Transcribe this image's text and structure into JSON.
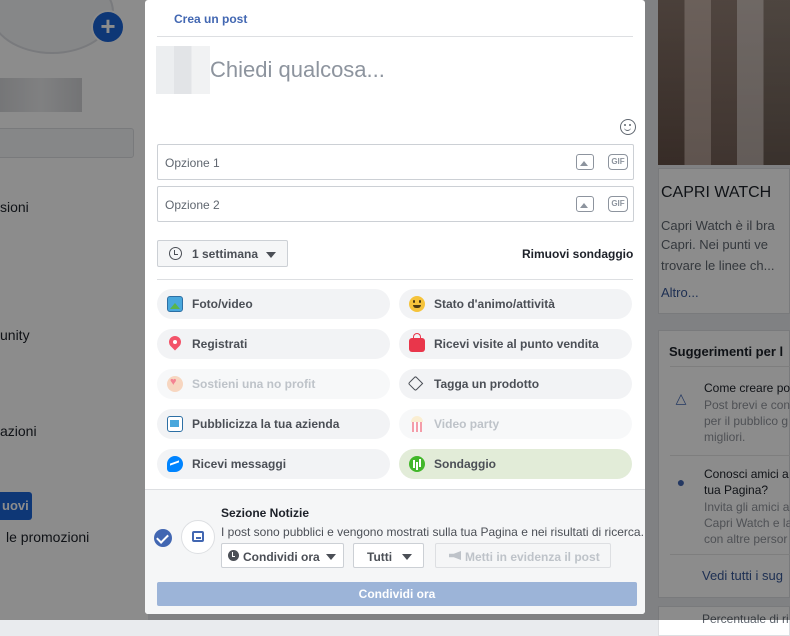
{
  "background_left": {
    "items": [
      "sioni",
      "unity",
      "azioni"
    ],
    "button_label": "uovi",
    "promo_text": "le promozioni"
  },
  "background_right": {
    "page_name": "CAPRI WATCH",
    "description_lines": [
      "Capri Watch è il bra",
      "Capri. Nei punti ve",
      "trovare le linee ch..."
    ],
    "more_link": "Altro...",
    "suggestions_title": "Suggerimenti per l",
    "suggestion1_title": "Come creare po",
    "suggestion1_lines": [
      "Post brevi e con",
      "per il pubblico g",
      "migliori."
    ],
    "suggestion2_title_lines": [
      "Conosci amici a",
      "tua Pagina?"
    ],
    "suggestion2_lines": [
      "Invita gli amici a",
      "Capri Watch e la",
      "con altre persor"
    ],
    "see_all": "Vedi tutti i sug",
    "bottom_text": "Percentuale di ri"
  },
  "modal": {
    "title": "Crea un post",
    "question_placeholder": "Chiedi qualcosa...",
    "options": [
      {
        "placeholder": "Opzione 1",
        "gif_label": "GIF"
      },
      {
        "placeholder": "Opzione 2",
        "gif_label": "GIF"
      }
    ],
    "duration": "1 settimana",
    "remove_poll": "Rimuovi sondaggio",
    "actions": [
      {
        "label": "Foto/video",
        "icon": "photo-icon",
        "state": "normal"
      },
      {
        "label": "Stato d'animo/attività",
        "icon": "smile-icon",
        "state": "normal"
      },
      {
        "label": "Registrati",
        "icon": "location-pin-icon",
        "state": "normal"
      },
      {
        "label": "Ricevi visite al punto vendita",
        "icon": "shopping-bag-icon",
        "state": "normal"
      },
      {
        "label": "Sostieni una no profit",
        "icon": "donation-heart-icon",
        "state": "disabled"
      },
      {
        "label": "Tagga un prodotto",
        "icon": "tag-icon",
        "state": "normal"
      },
      {
        "label": "Pubblicizza la tua azienda",
        "icon": "advertise-icon",
        "state": "normal"
      },
      {
        "label": "Video party",
        "icon": "popcorn-icon",
        "state": "disabled"
      },
      {
        "label": "Ricevi messaggi",
        "icon": "messenger-icon",
        "state": "normal"
      },
      {
        "label": "Sondaggio",
        "icon": "poll-icon",
        "state": "selected"
      }
    ],
    "footer": {
      "section_title": "Sezione Notizie",
      "section_desc": "I post sono pubblici e vengono mostrati sulla tua Pagina e nei risultati di ricerca.",
      "share_now_dropdown": "Condividi ora",
      "audience_dropdown": "Tutti",
      "boost_label": "Metti in evidenza il post",
      "submit_label": "Condividi ora"
    }
  },
  "colors": {
    "accent": "#4267b2",
    "submit_disabled": "#9cb4d8",
    "poll_selected_bg": "#e2ecd8",
    "overlay": "rgba(0,0,0,0.45)"
  }
}
